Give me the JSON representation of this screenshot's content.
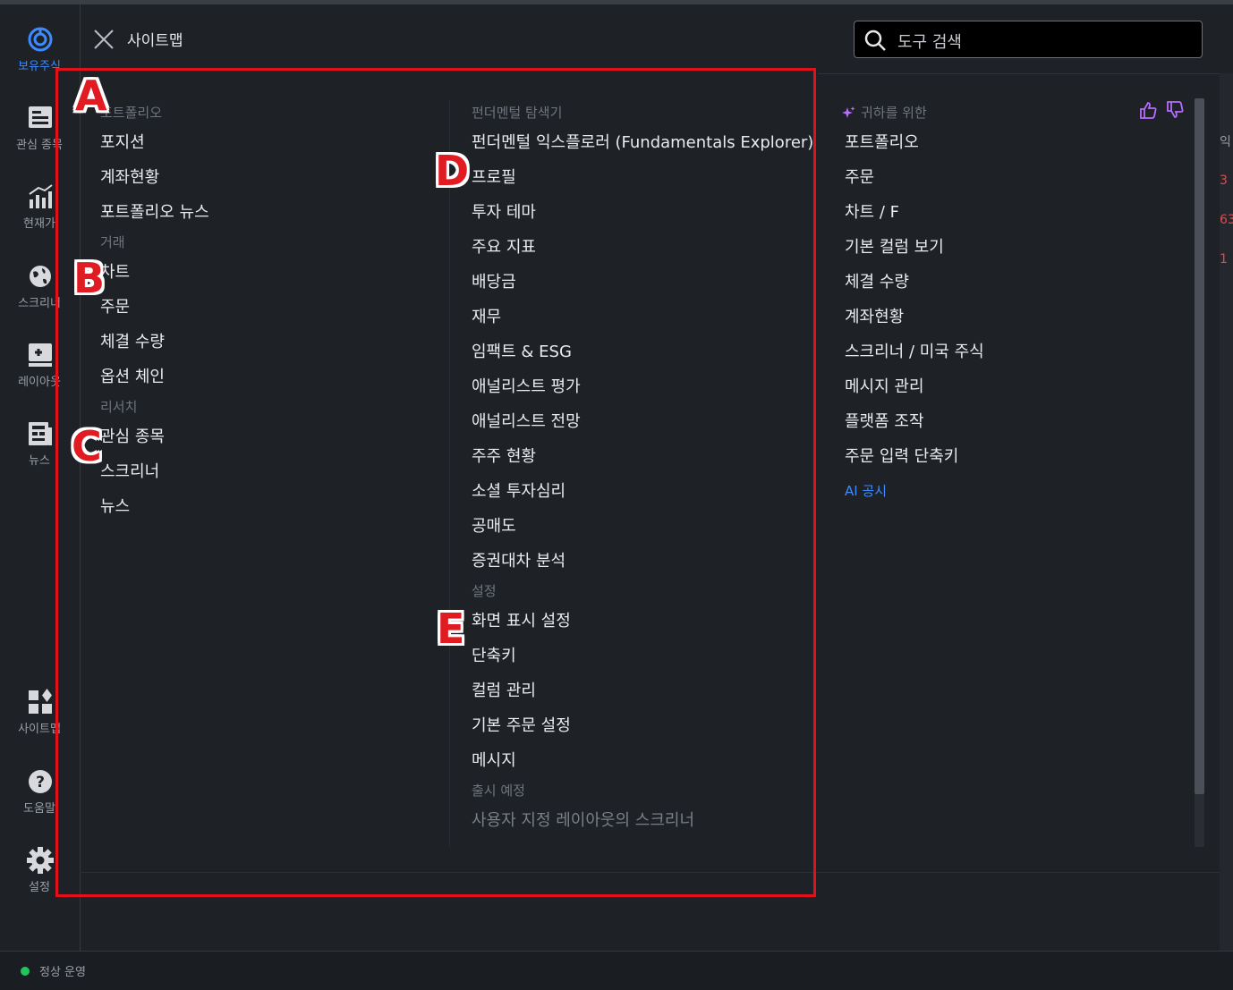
{
  "header": {
    "title": "사이트맵",
    "search_placeholder": "도구 검색"
  },
  "rail": [
    {
      "label": "보유주식",
      "icon": "portfolio-icon",
      "active": true
    },
    {
      "label": "관심 종목",
      "icon": "watchlist-icon"
    },
    {
      "label": "현재가",
      "icon": "quote-chart-icon"
    },
    {
      "label": "스크리너",
      "icon": "globe-icon"
    },
    {
      "label": "레이아웃",
      "icon": "layout-add-icon"
    },
    {
      "label": "뉴스",
      "icon": "news-icon"
    },
    {
      "label": "사이트맵",
      "icon": "sitemap-grid-icon"
    },
    {
      "label": "도움말",
      "icon": "help-icon"
    },
    {
      "label": "설정",
      "icon": "gear-icon"
    }
  ],
  "col1": {
    "sections": [
      {
        "title": "포트폴리오",
        "items": [
          "포지션",
          "계좌현황",
          "포트폴리오 뉴스"
        ]
      },
      {
        "title": "거래",
        "items": [
          "차트",
          "주문",
          "체결 수량",
          "옵션 체인"
        ]
      },
      {
        "title": "리서치",
        "items": [
          "관심 종목",
          "스크리너",
          "뉴스"
        ]
      }
    ]
  },
  "col2": {
    "sections": [
      {
        "title": "펀더멘털 탐색기",
        "items": [
          "펀더멘털 익스플로러 (Fundamentals Explorer)",
          "프로필",
          "투자 테마",
          "주요 지표",
          "배당금",
          "재무",
          "임팩트 & ESG",
          "애널리스트 평가",
          "애널리스트 전망",
          "주주 현황",
          "소셜 투자심리",
          "공매도",
          "증권대차 분석"
        ]
      },
      {
        "title": "설정",
        "items": [
          "화면 표시 설정",
          "단축키",
          "컬럼 관리",
          "기본 주문 설정",
          "메시지"
        ]
      },
      {
        "title": "출시 예정",
        "items": [
          "사용자 지정 레이아웃의 스크리너"
        ]
      }
    ]
  },
  "col3": {
    "title": "귀하를 위한",
    "items": [
      "포트폴리오",
      "주문",
      "차트 / F",
      "기본 컬럼 보기",
      "체결 수량",
      "계좌현황",
      "스크리너 / 미국 주식",
      "메시지 관리",
      "플랫폼 조작",
      "주문 입력 단축키"
    ],
    "link": "AI 공시"
  },
  "edge_fragments": [
    "익",
    "3",
    "63",
    "1"
  ],
  "status": {
    "text": "정상 운영",
    "color": "#1fc65b"
  },
  "annotations": [
    "A",
    "B",
    "C",
    "D",
    "E"
  ],
  "colors": {
    "accent": "#3d8bff",
    "annotation": "#e3101b",
    "sparkle": "#b56cff"
  }
}
